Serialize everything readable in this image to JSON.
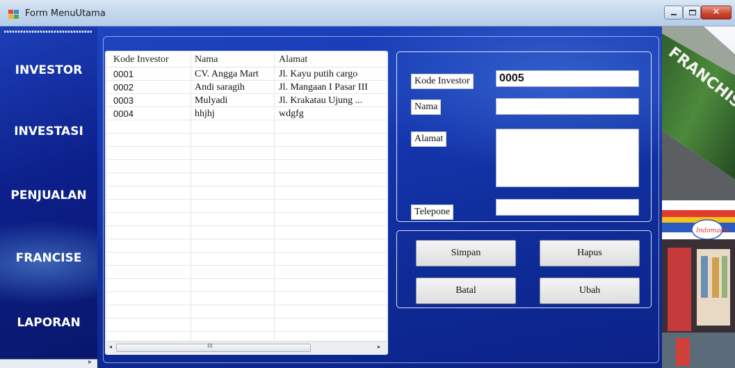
{
  "window": {
    "title": "Form MenuUtama",
    "close_glyph": "✕"
  },
  "sidebar": {
    "items": [
      {
        "label": "INVESTOR"
      },
      {
        "label": "INVESTASI"
      },
      {
        "label": "PENJUALAN"
      },
      {
        "label": "FRANCISE"
      },
      {
        "label": "LAPORAN"
      }
    ],
    "footer_glyph": "▸"
  },
  "grid": {
    "columns": [
      "Kode Investor",
      "Nama",
      "Alamat"
    ],
    "rows": [
      [
        "0001",
        "CV. Angga Mart",
        "Jl. Kayu putih cargo"
      ],
      [
        "0002",
        "Andi saragih",
        "Jl. Mangaan I Pasar III"
      ],
      [
        "0003",
        "Mulyadi",
        "Jl. Krakatau Ujung ..."
      ],
      [
        "0004",
        "hhjhj",
        "wdgfg"
      ]
    ],
    "scroll": {
      "left": "◂",
      "right": "▸",
      "grip": "III"
    }
  },
  "form": {
    "kode_label": "Kode Investor",
    "kode_value": "0005",
    "nama_label": "Nama",
    "nama_value": "",
    "alamat_label": "Alamat",
    "alamat_value": "",
    "telepone_label": "Telepone",
    "telepone_value": ""
  },
  "buttons": {
    "simpan": "Simpan",
    "hapus": "Hapus",
    "batal": "Batal",
    "ubah": "Ubah"
  },
  "photo": {
    "sign_text": "FRANCHISING",
    "logo_text": "Indomaret"
  },
  "colors": {
    "nav_bg": "#0c1f8a",
    "main_bg": "#1436ae",
    "close_btn": "#c8442d"
  }
}
